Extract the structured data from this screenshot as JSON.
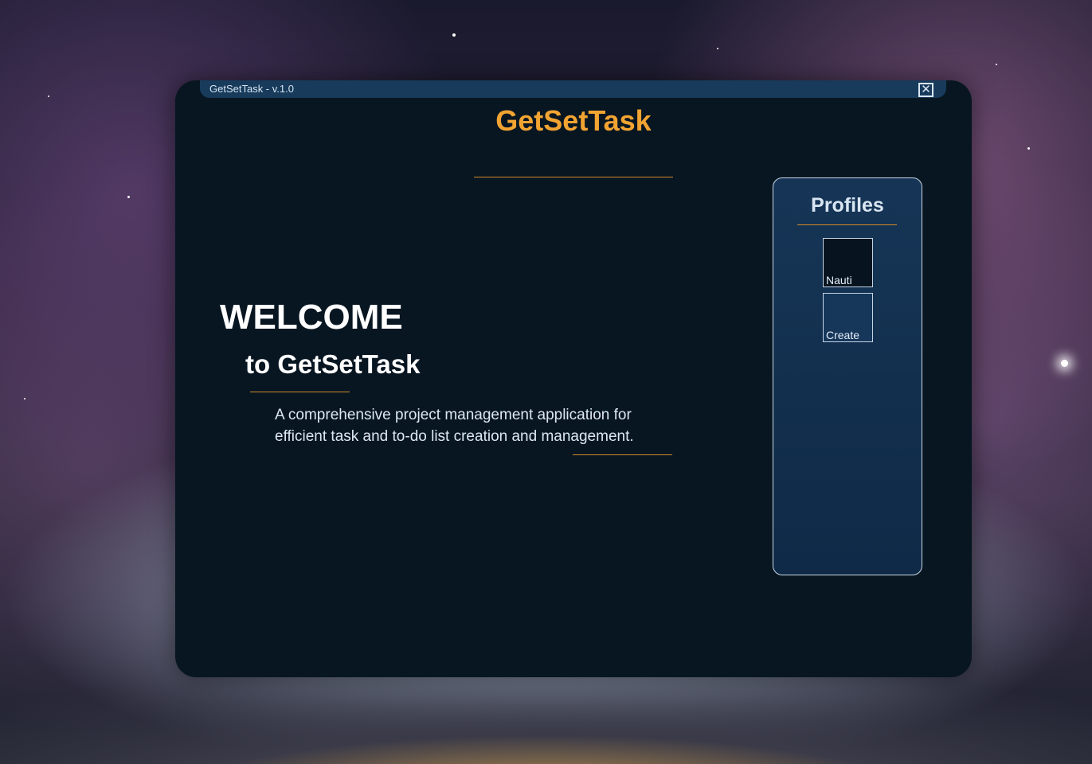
{
  "window": {
    "title": "GetSetTask - v.1.0",
    "close_symbol": "✕"
  },
  "header": {
    "app_name": "GetSetTask"
  },
  "welcome": {
    "heading": "WELCOME",
    "subheading": "to GetSetTask",
    "description_line1": "A comprehensive project management application for",
    "description_line2": "efficient task and to-do list creation and management."
  },
  "profiles": {
    "title": "Profiles",
    "items": [
      {
        "label": "Nauti"
      },
      {
        "label": "Create"
      }
    ]
  },
  "colors": {
    "accent": "#f2a432",
    "window_bg": "#081622",
    "panel_bg": "#163556"
  }
}
